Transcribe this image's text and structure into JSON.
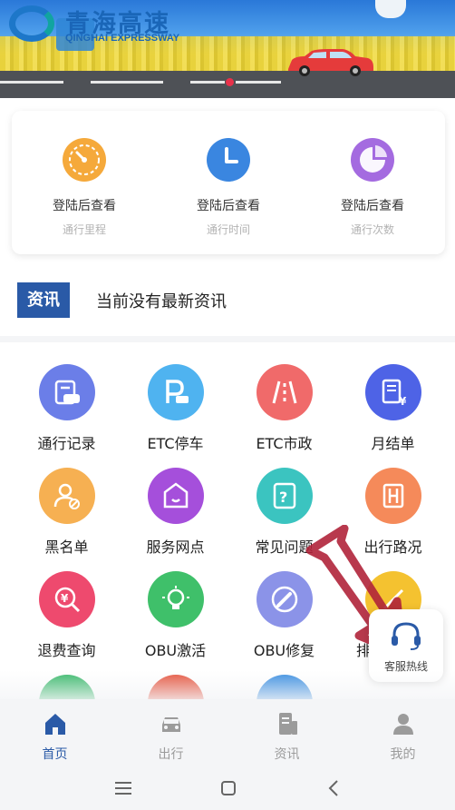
{
  "banner": {
    "brand_cn": "青海高速",
    "brand_en": "QINGHAI EXPRESSWAY"
  },
  "stats": [
    {
      "value": "登陆后查看",
      "label": "通行里程",
      "icon": "speedometer-icon",
      "color": "#f5a93b"
    },
    {
      "value": "登陆后查看",
      "label": "通行时间",
      "icon": "clock-icon",
      "color": "#3a86e0"
    },
    {
      "value": "登陆后查看",
      "label": "通行次数",
      "icon": "pie-chart-icon",
      "color": "#a46be0"
    }
  ],
  "news": {
    "tag": "资讯",
    "text": "当前没有最新资讯"
  },
  "grid": [
    {
      "label": "通行记录",
      "icon": "car-record-icon",
      "color": "#6b7ee8"
    },
    {
      "label": "ETC停车",
      "icon": "parking-icon",
      "color": "#4fb3f0"
    },
    {
      "label": "ETC市政",
      "icon": "road-icon",
      "color": "#f06a6a"
    },
    {
      "label": "月结单",
      "icon": "bill-icon",
      "color": "#4e63e6"
    },
    {
      "label": "黑名单",
      "icon": "blacklist-user-icon",
      "color": "#f6b052"
    },
    {
      "label": "服务网点",
      "icon": "service-point-icon",
      "color": "#a54fdb"
    },
    {
      "label": "常见问题",
      "icon": "question-icon",
      "color": "#3bc4c0"
    },
    {
      "label": "出行路况",
      "icon": "traffic-icon",
      "color": "#f58a5a"
    },
    {
      "label": "退费查询",
      "icon": "refund-search-icon",
      "color": "#ee4a6e"
    },
    {
      "label": "OBU激活",
      "icon": "bulb-icon",
      "color": "#3fc06a"
    },
    {
      "label": "OBU修复",
      "icon": "wrench-icon",
      "color": "#8b93e8"
    },
    {
      "label": "排",
      "icon": "tools-icon",
      "color": "#f4c230"
    },
    {
      "label": "",
      "icon": "more-icon-1",
      "color": "#38b86a"
    },
    {
      "label": "",
      "icon": "more-icon-2",
      "color": "#e5533d"
    },
    {
      "label": "",
      "icon": "more-icon-3",
      "color": "#3a8ee0"
    }
  ],
  "hotline": {
    "label": "客服热线"
  },
  "tabs": [
    {
      "label": "首页",
      "icon": "home-icon",
      "active": true
    },
    {
      "label": "出行",
      "icon": "car-icon",
      "active": false
    },
    {
      "label": "资讯",
      "icon": "news-icon",
      "active": false
    },
    {
      "label": "我的",
      "icon": "user-icon",
      "active": false
    }
  ],
  "system_nav": {
    "menu": "menu-icon",
    "home": "square-home-icon",
    "back": "back-icon"
  },
  "colors": {
    "accent": "#2a5aa7",
    "inactive": "#9b9b9b"
  }
}
